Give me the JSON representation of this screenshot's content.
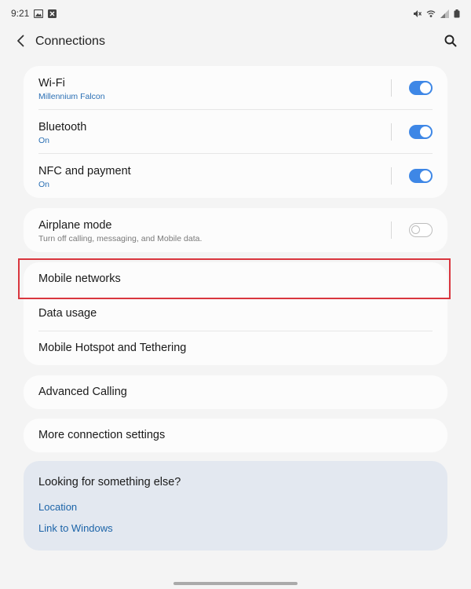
{
  "status_bar": {
    "time": "9:21",
    "left_icons": [
      "gallery-icon",
      "notification-icon"
    ],
    "right_icons": [
      "mute-icon",
      "wifi-icon",
      "signal-icon",
      "battery-icon"
    ]
  },
  "header": {
    "title": "Connections",
    "back_icon": "chevron-left-icon",
    "search_icon": "search-icon"
  },
  "group1": {
    "items": [
      {
        "label": "Wi-Fi",
        "status": "Millennium Falcon",
        "toggle": "on"
      },
      {
        "label": "Bluetooth",
        "status": "On",
        "toggle": "on"
      },
      {
        "label": "NFC and payment",
        "status": "On",
        "toggle": "on"
      }
    ]
  },
  "group2": {
    "label": "Airplane mode",
    "description": "Turn off calling, messaging, and Mobile data.",
    "toggle": "off"
  },
  "group3": {
    "items": [
      {
        "label": "Mobile networks",
        "highlighted": true
      },
      {
        "label": "Data usage"
      },
      {
        "label": "Mobile Hotspot and Tethering"
      }
    ]
  },
  "advanced_calling": {
    "label": "Advanced Calling"
  },
  "more_settings": {
    "label": "More connection settings"
  },
  "suggestions": {
    "title": "Looking for something else?",
    "links": [
      "Location",
      "Link to Windows"
    ]
  },
  "colors": {
    "accent": "#3e87e6",
    "link": "#1c64a8",
    "status_text": "#2a6fb4",
    "highlight": "#d9363e",
    "background": "#f4f4f4",
    "card": "#fcfcfc",
    "suggestion_card": "#e3e8f0"
  }
}
